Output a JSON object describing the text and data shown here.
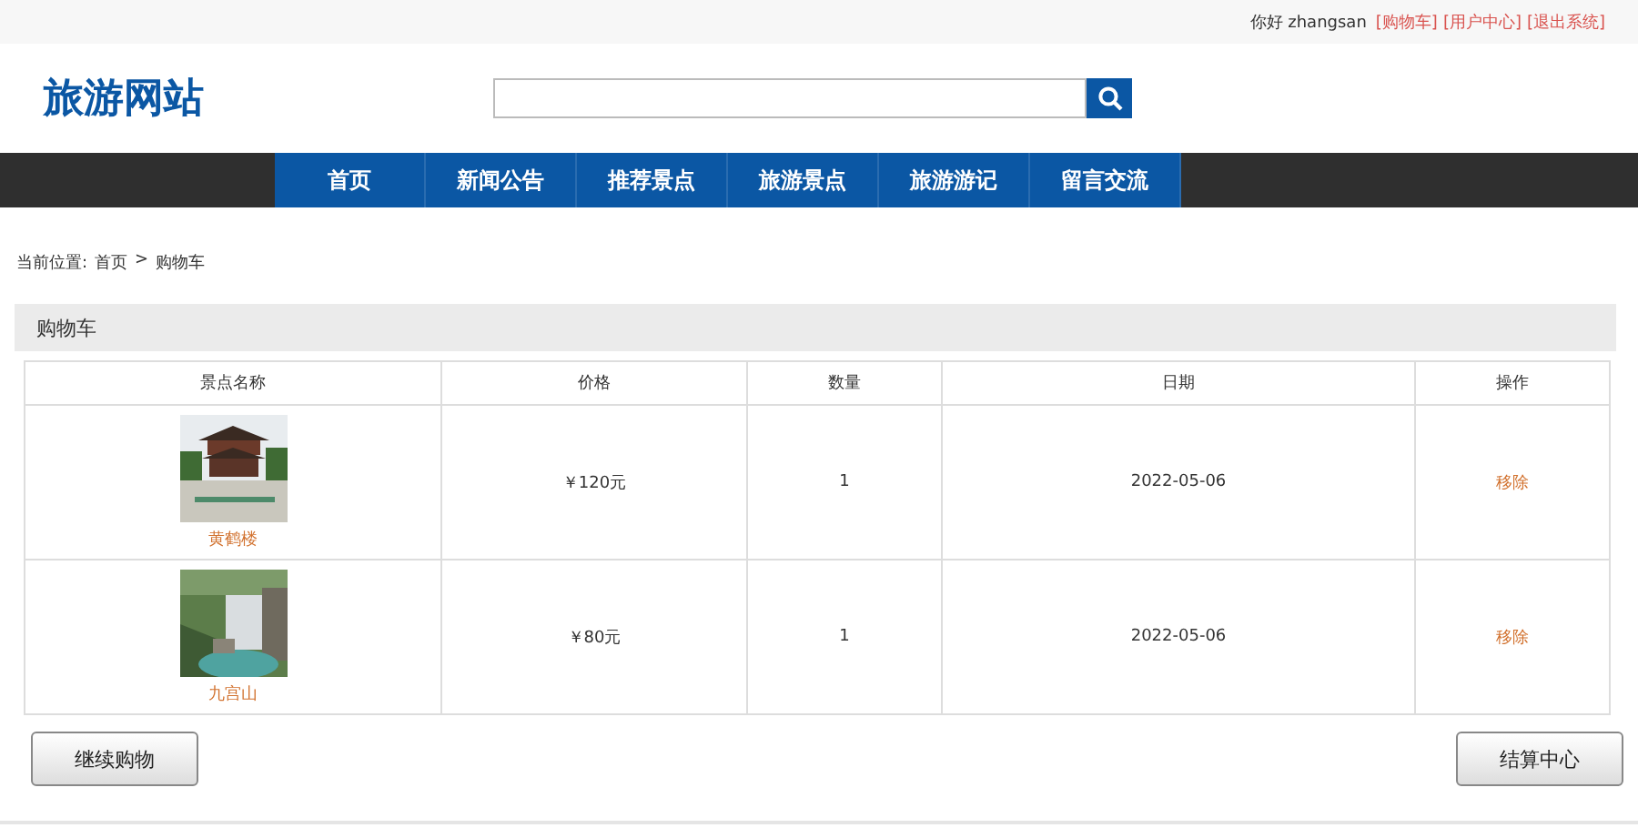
{
  "top_bar": {
    "greeting": "你好 zhangsan",
    "links": [
      "[购物车]",
      "[用户中心]",
      "[退出系统]"
    ]
  },
  "header": {
    "logo": "旅游网站"
  },
  "nav": {
    "items": [
      {
        "label": "首页",
        "selected": false
      },
      {
        "label": "新闻公告",
        "selected": false
      },
      {
        "label": "推荐景点",
        "selected": false
      },
      {
        "label": "旅游景点",
        "selected": false
      },
      {
        "label": "旅游游记",
        "selected": false
      },
      {
        "label": "留言交流",
        "selected": false
      }
    ]
  },
  "breadcrumb": {
    "prefix": "当前位置:",
    "items": [
      "首页",
      "购物车"
    ],
    "separator": ">"
  },
  "cart": {
    "title": "购物车",
    "table": {
      "columns": [
        "景点名称",
        "价格",
        "数量",
        "日期",
        "操作"
      ],
      "rows": [
        {
          "name": "黄鹤楼",
          "price": "￥120元",
          "quantity": "1",
          "date": "2022-05-06",
          "action": "移除"
        },
        {
          "name": "九宫山",
          "price": "￥80元",
          "quantity": "1",
          "date": "2022-05-06",
          "action": "移除"
        }
      ]
    },
    "buttons": [
      "继续购物",
      "结算中心"
    ]
  }
}
